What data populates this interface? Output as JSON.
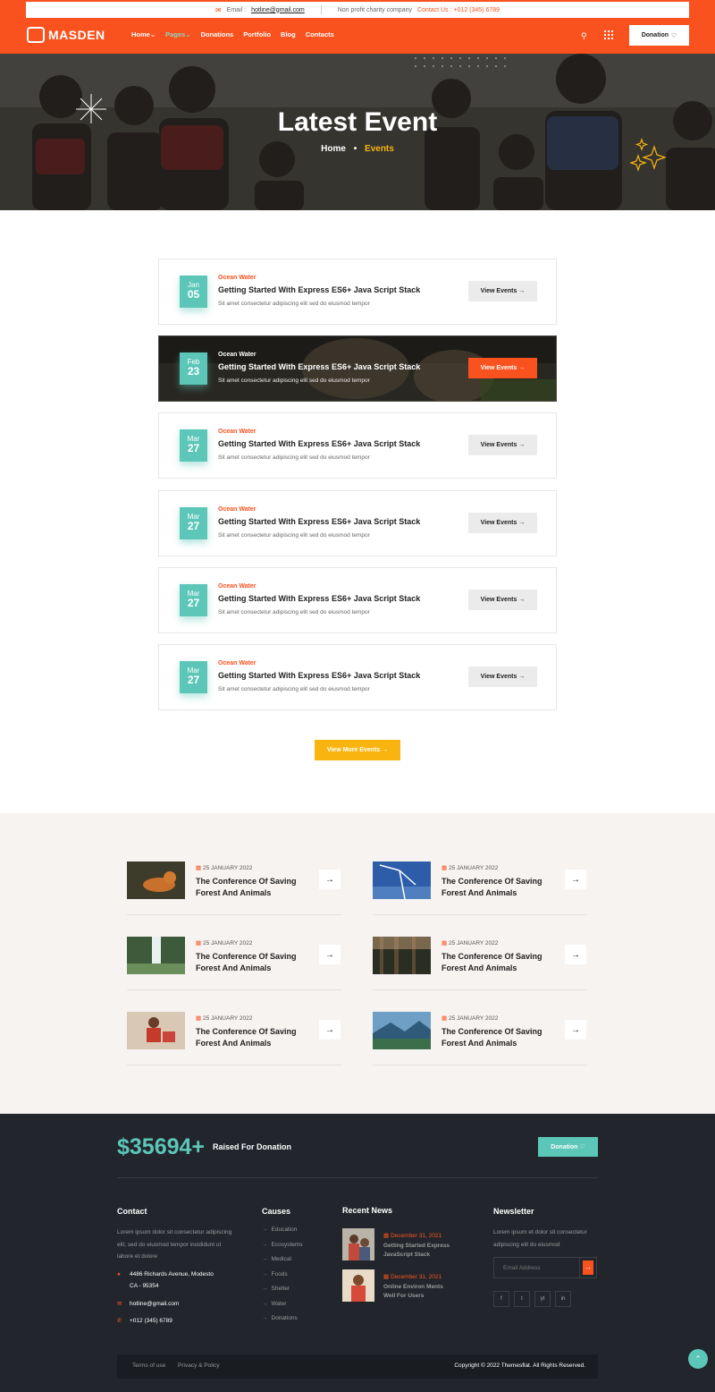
{
  "topbar": {
    "email_label": "Email :",
    "email": "hotline@gmail.com",
    "tagline": "Non profit charity company",
    "contact_label": "Contact Us : +012 (345) 6789"
  },
  "brand": {
    "name": "MASDEN"
  },
  "nav": {
    "items": [
      {
        "label": "Home"
      },
      {
        "label": "Pages"
      },
      {
        "label": "Donations"
      },
      {
        "label": "Portfolio"
      },
      {
        "label": "Blog"
      },
      {
        "label": "Contacts"
      }
    ],
    "chevron": "⌄",
    "donation_label": "Donation",
    "heart": "♡"
  },
  "hero": {
    "title": "Latest Event",
    "crumb_home": "Home",
    "crumb_sep": "•",
    "crumb_current": "Events"
  },
  "events": [
    {
      "month": "Jan",
      "day": "05",
      "category": "Ocean Water",
      "title": "Getting Started With Express ES6+ Java Script Stack",
      "desc": "Sit amet consectetur adipiscing elit sed do eiusmod tempor",
      "button": "View Events"
    },
    {
      "month": "Feb",
      "day": "23",
      "category": "Ocean Water",
      "title": "Getting Started With Express ES6+ Java Script Stack",
      "desc": "Sit amet consectetur adipiscing elit sed do eiusmod tempor",
      "button": "View Events"
    },
    {
      "month": "Mar",
      "day": "27",
      "category": "Ocean Water",
      "title": "Getting Started With Express ES6+ Java Script Stack",
      "desc": "Sit amet consectetur adipiscing elit sed do eiusmod tempor",
      "button": "View Events"
    },
    {
      "month": "Mar",
      "day": "27",
      "category": "Ocean Water",
      "title": "Getting Started With Express ES6+ Java Script Stack",
      "desc": "Sit amet consectetur adipiscing elit sed do eiusmod tempor",
      "button": "View Events"
    },
    {
      "month": "Mar",
      "day": "27",
      "category": "Ocean Water",
      "title": "Getting Started With Express ES6+ Java Script Stack",
      "desc": "Sit amet consectetur adipiscing elit sed do eiusmod tempor",
      "button": "View Events"
    },
    {
      "month": "Mar",
      "day": "27",
      "category": "Ocean Water",
      "title": "Getting Started With Express ES6+ Java Script Stack",
      "desc": "Sit amet consectetur adipiscing elit sed do eiusmod tempor",
      "button": "View Events"
    }
  ],
  "arrow": "→",
  "more_events": "View More Events",
  "news": [
    {
      "date": "25 JANUARY 2022",
      "title": "The Conference Of Saving Forest And Animals"
    },
    {
      "date": "25 JANUARY 2022",
      "title": "The Conference Of Saving Forest And Animals"
    },
    {
      "date": "25 JANUARY 2022",
      "title": "The Conference Of Saving Forest And Animals"
    },
    {
      "date": "25 JANUARY 2022",
      "title": "The Conference Of Saving Forest And Animals"
    },
    {
      "date": "25 JANUARY 2022",
      "title": "The Conference Of Saving Forest And Animals"
    },
    {
      "date": "25 JANUARY 2022",
      "title": "The Conference Of Saving Forest And Animals"
    }
  ],
  "footer": {
    "raised_amount": "$35694+",
    "raised_label": "Raised For Donation",
    "donation_label": "Donation",
    "contact_heading": "Contact",
    "contact_text": "Lorem ipsum dolor sit consectetur adipiscing elit, sed do eiusmod tempor incididunt ut labore et dolore",
    "address_line1": "4486 Richards Avenue, Modesto",
    "address_line2": "CA - 95354",
    "email": "hotline@gmail.com",
    "phone": "+012 (345) 6789",
    "causes_heading": "Causes",
    "causes": [
      "Education",
      "Ecosystems",
      "Medical",
      "Foods",
      "Shelter",
      "Water",
      "Donations"
    ],
    "recent_heading": "Recent News",
    "recent": [
      {
        "date": "December 31, 2021",
        "title_line1": "Getting Started Express",
        "title_line2": "JavaScript Stack"
      },
      {
        "date": "December 31, 2021",
        "title_line1": "Online Environ Ments",
        "title_line2": "Well For Users"
      }
    ],
    "newsletter_heading": "Newsletter",
    "newsletter_text": "Lorem ipsum et dolor sit consectetur adipiscing elit do eiusmod",
    "email_placeholder": "Email Address",
    "social": [
      "f",
      "t",
      "yt",
      "in"
    ],
    "terms": "Terms of use",
    "privacy": "Privacy & Policy",
    "copyright": "Copyright © 2022 Themesflat. All Rights Reserved."
  },
  "to_top": "⌃",
  "colors": {
    "primary": "#f9521e",
    "teal": "#5cc6b8",
    "yellow": "#f9b410",
    "dark": "#22262c"
  }
}
